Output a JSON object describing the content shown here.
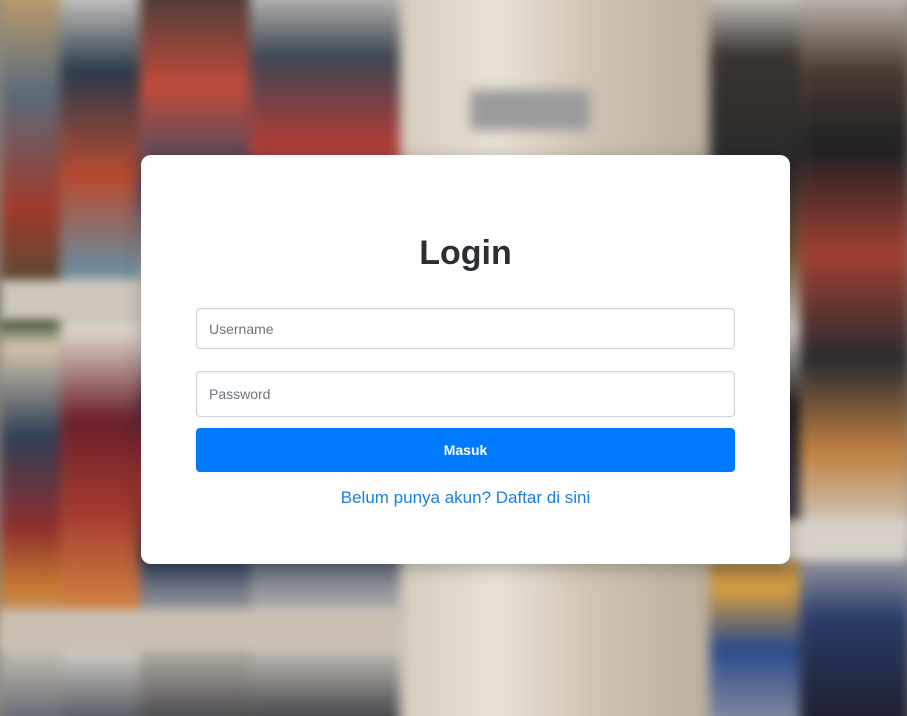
{
  "login": {
    "title": "Login",
    "username_placeholder": "Username",
    "username_value": "",
    "password_placeholder": "Password",
    "password_value": "",
    "submit_label": "Masuk",
    "register_link": "Belum punya akun? Daftar di sini"
  },
  "colors": {
    "primary": "#007bff",
    "link": "#1a7fe0",
    "card_bg": "#ffffff",
    "title": "#2b2f33"
  }
}
